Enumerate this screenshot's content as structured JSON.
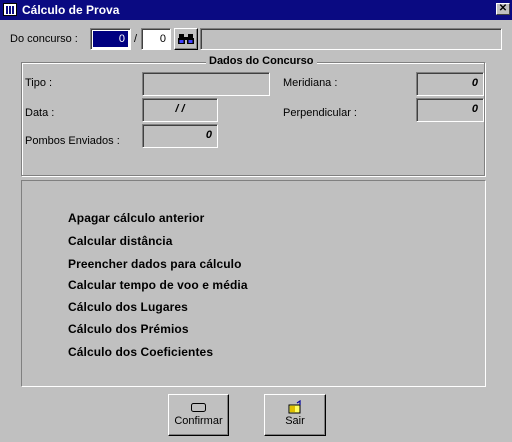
{
  "window": {
    "title": "Cálculo de Prova",
    "close_glyph": "✕"
  },
  "concurso": {
    "label": "Do concurso :",
    "number_value": "0",
    "separator": "/",
    "year_value": "0",
    "search_icon": "binoculars-icon",
    "description_value": ""
  },
  "dados": {
    "legend": "Dados do Concurso",
    "tipo_label": "Tipo :",
    "tipo_value": "",
    "data_label": "Data :",
    "data_value": "/ /",
    "pombos_label": "Pombos Enviados :",
    "pombos_value": "0",
    "meridiana_label": "Meridiana :",
    "meridiana_value": "0",
    "perpendicular_label": "Perpendicular :",
    "perpendicular_value": "0"
  },
  "menu": {
    "items": [
      "Apagar cálculo anterior",
      "Calcular distância",
      "Preencher dados para cálculo",
      "Calcular tempo de voo e média",
      "Cálculo dos Lugares",
      "Cálculo dos Prémios",
      "Cálculo dos Coeficientes"
    ]
  },
  "buttons": {
    "confirm_label": "Confirmar",
    "confirm_icon": "confirm-icon",
    "exit_label": "Sair",
    "exit_icon": "exit-door-icon"
  },
  "colors": {
    "titlebar": "#0a0a82",
    "face": "#c0c0c0",
    "selection": "#000080"
  }
}
